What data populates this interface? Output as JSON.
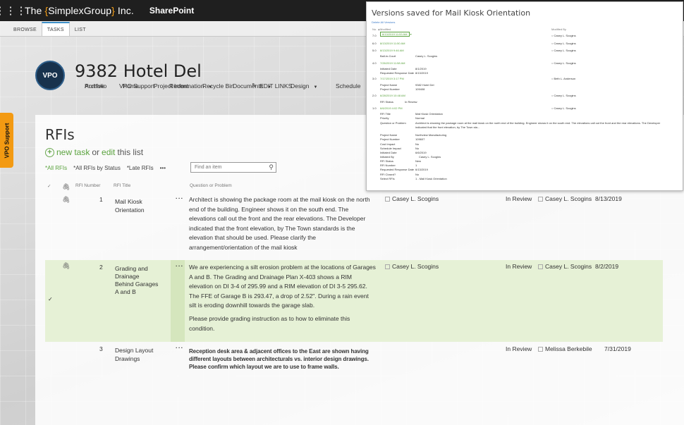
{
  "suitebar": {
    "brand_pre": "The ",
    "brand_open": "{",
    "brand_mid": "SimplexGroup",
    "brand_close": "}",
    "brand_post": " Inc.",
    "app": "SharePoint"
  },
  "ribbon": {
    "tabs": [
      "BROWSE",
      "TASKS",
      "LIST"
    ],
    "active": "TASKS"
  },
  "site": {
    "logo_text": "VPO",
    "title": "9382 Hotel Del",
    "nav_row1": [
      "Portfolio",
      "Home",
      "Project Information",
      "Documents",
      "Design",
      "Schedule"
    ],
    "nav_row2": [
      "Archive",
      "VPO Support",
      "Recent",
      "Recycle Bin"
    ],
    "edit_links": "EDIT LINKS"
  },
  "vpo_tab": "VPO Support",
  "list": {
    "title": "RFIs",
    "new_task": "new task",
    "or": "or",
    "edit": "edit",
    "this_list": "this list",
    "views": [
      "*All RFIs",
      "*All RFIs by Status",
      "*Late RFIs",
      "•••"
    ],
    "search_placeholder": "Find an item",
    "columns": {
      "number": "RFI Number",
      "title": "RFI Title",
      "question": "Question or Problem"
    },
    "rows": [
      {
        "number": "1",
        "title": "Mail Kiosk\nOrientation",
        "question": [
          "Architect is showing the package room at the mail kiosk on the north end of the building. Engineer shows it on the south end. The elevations call out the front and the rear elevations. The Developer indicated that the front elevation, by The Town standards is the elevation that should be used. Please clarify the arrangement/orientation of the mail kiosk"
        ],
        "assigned": "Casey L. Scogins",
        "status": "In Review",
        "initiated_by": "Casey L. Scogins",
        "date": "8/13/2019"
      },
      {
        "number": "2",
        "title": "Grading and\nDrainage\nBehind Garages\nA and B",
        "question": [
          "We are experiencing a silt erosion problem at the locations of Garages A and B. The Grading and Drainage Plan X-403 shows a RIM elevation on DI 3-4 of 295.99 and a RIM elevation of DI 3-5 295.62. The FFE of Garage B is 293.47, a drop of 2.52\". During a rain event silt is eroding downhill towards the garage slab.",
          "Please provide grading instruction as to how to eliminate this condition."
        ],
        "assigned": "Casey L. Scogins",
        "status": "In Review",
        "initiated_by": "Casey L. Scogins",
        "date": "8/2/2019"
      },
      {
        "number": "3",
        "title": "Design Layout\nDrawings",
        "question": [
          "Reception desk area & adjacent offices to the East are shown having different layouts between architecturals vs. interior design drawings. Please confirm which layout we are to use to frame walls."
        ],
        "assigned": "",
        "status": "In Review",
        "initiated_by": "Melissa Berkebile",
        "date": "7/31/2019"
      }
    ]
  },
  "versions": {
    "title": "Versions saved for Mail Kiosk Orientation",
    "delete_all": "Delete All Versions",
    "col_no": "No. ▲",
    "col_modified": "Modified",
    "col_by": "Modified By",
    "entries": [
      {
        "no": "7.0",
        "date": "8/13/2019 11:53 AM",
        "by": "Casey L. Scogins"
      },
      {
        "no": "6.0",
        "date": "8/13/2019 11:50 AM",
        "by": "Casey L. Scogins"
      },
      {
        "no": "5.0",
        "date": "8/13/2019 9:46 AM",
        "by": "Casey L. Scogins"
      },
      {
        "no": "4.0",
        "date": "7/26/2019 11:58 AM",
        "by": "Casey L. Scogins"
      },
      {
        "no": "3.0",
        "date": "7/17/2019 3:17 PM",
        "by": "Beth L. Anderson"
      },
      {
        "no": "2.0",
        "date": "6/28/2019 10:48 AM",
        "by": "Casey L. Scogins"
      },
      {
        "no": "1.0",
        "date": "6/6/2019 4:02 PM",
        "by": "Casey L. Scogins"
      }
    ],
    "v5_fields": [
      {
        "k": "Ball-in-Court",
        "v": "Casey L. Scogins"
      }
    ],
    "v4_fields": [
      {
        "k": "Initiated Date",
        "v": "8/1/2019"
      },
      {
        "k": "Requested Response Date",
        "v": "8/13/2019"
      }
    ],
    "v3_fields": [
      {
        "k": "Project Name",
        "v": "9382 Hotel Del"
      },
      {
        "k": "Project Number",
        "v": "109408"
      }
    ],
    "v2_fields": [
      {
        "k": "RFI Status",
        "v": "In Review"
      }
    ],
    "v1_fields": [
      {
        "k": "RFI Title",
        "v": "Mail Kiosk Orientation"
      },
      {
        "k": "Priority",
        "v": "Normal"
      },
      {
        "k": "Question or Problem",
        "v": "Architect is showing the package room at the mail kiosk on the north end of the building. Engineer shows it on the south end. The elevations call out the front and the rear elevations. The Developer"
      },
      {
        "k": "",
        "v": "indicated that the front elevation, by The Town sta..."
      },
      {
        "k": "Project Name",
        "v": "Northview Manufacturing"
      },
      {
        "k": "Project Number",
        "v": "109607"
      },
      {
        "k": "Cost Impact",
        "v": "No"
      },
      {
        "k": "Schedule Impact",
        "v": "No"
      },
      {
        "k": "Initiated Date",
        "v": "6/6/2019"
      },
      {
        "k": "Initiated By",
        "v": "Casey L. Scogins"
      },
      {
        "k": "RFI Status",
        "v": "New"
      },
      {
        "k": "RFI Number",
        "v": "1"
      },
      {
        "k": "Requested Response Date",
        "v": "6/13/2019"
      },
      {
        "k": "RFI Closed?",
        "v": "No"
      },
      {
        "k": "Select RFIs",
        "v": "1 - Mail Kiosk Orientation"
      }
    ]
  }
}
